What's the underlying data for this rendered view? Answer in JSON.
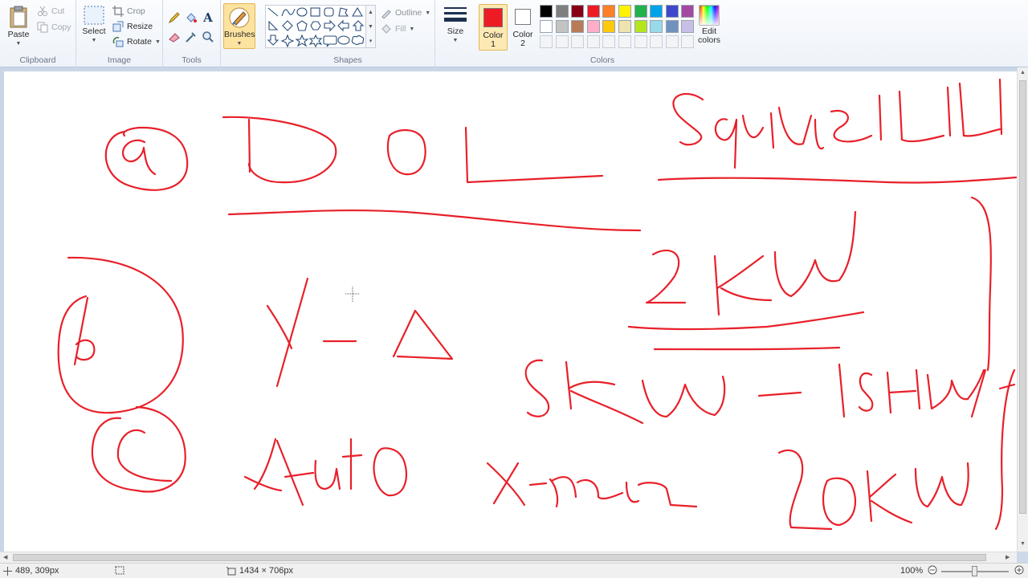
{
  "ribbon": {
    "clipboard": {
      "label": "Clipboard",
      "paste": "Paste",
      "cut": "Cut",
      "copy": "Copy"
    },
    "image": {
      "label": "Image",
      "select": "Select",
      "crop": "Crop",
      "resize": "Resize",
      "rotate": "Rotate"
    },
    "tools": {
      "label": "Tools"
    },
    "brushes": {
      "label": "Brushes"
    },
    "shapes": {
      "label": "Shapes",
      "outline": "Outline",
      "fill": "Fill"
    },
    "size": {
      "label": "Size"
    },
    "colors": {
      "label": "Colors",
      "color1": "Color",
      "color1_num": "1",
      "color2": "Color",
      "color2_num": "2",
      "edit": "Edit",
      "edit2": "colors",
      "color1_value": "#ed1c24",
      "color2_value": "#ffffff",
      "palette_row1": [
        "#000000",
        "#7f7f7f",
        "#880015",
        "#ed1c24",
        "#ff7f27",
        "#fff200",
        "#22b14c",
        "#00a2e8",
        "#3f48cc",
        "#a349a4"
      ],
      "palette_row2": [
        "#ffffff",
        "#c3c3c3",
        "#b97a57",
        "#ffaec9",
        "#ffc90e",
        "#efe4b0",
        "#b5e61d",
        "#99d9ea",
        "#7092be",
        "#c8bfe7"
      ]
    }
  },
  "canvas": {
    "stroke_color": "#e8202a"
  },
  "status": {
    "cursor_pos": "489, 309px",
    "image_size": "1434 × 706px",
    "zoom": "100%"
  }
}
